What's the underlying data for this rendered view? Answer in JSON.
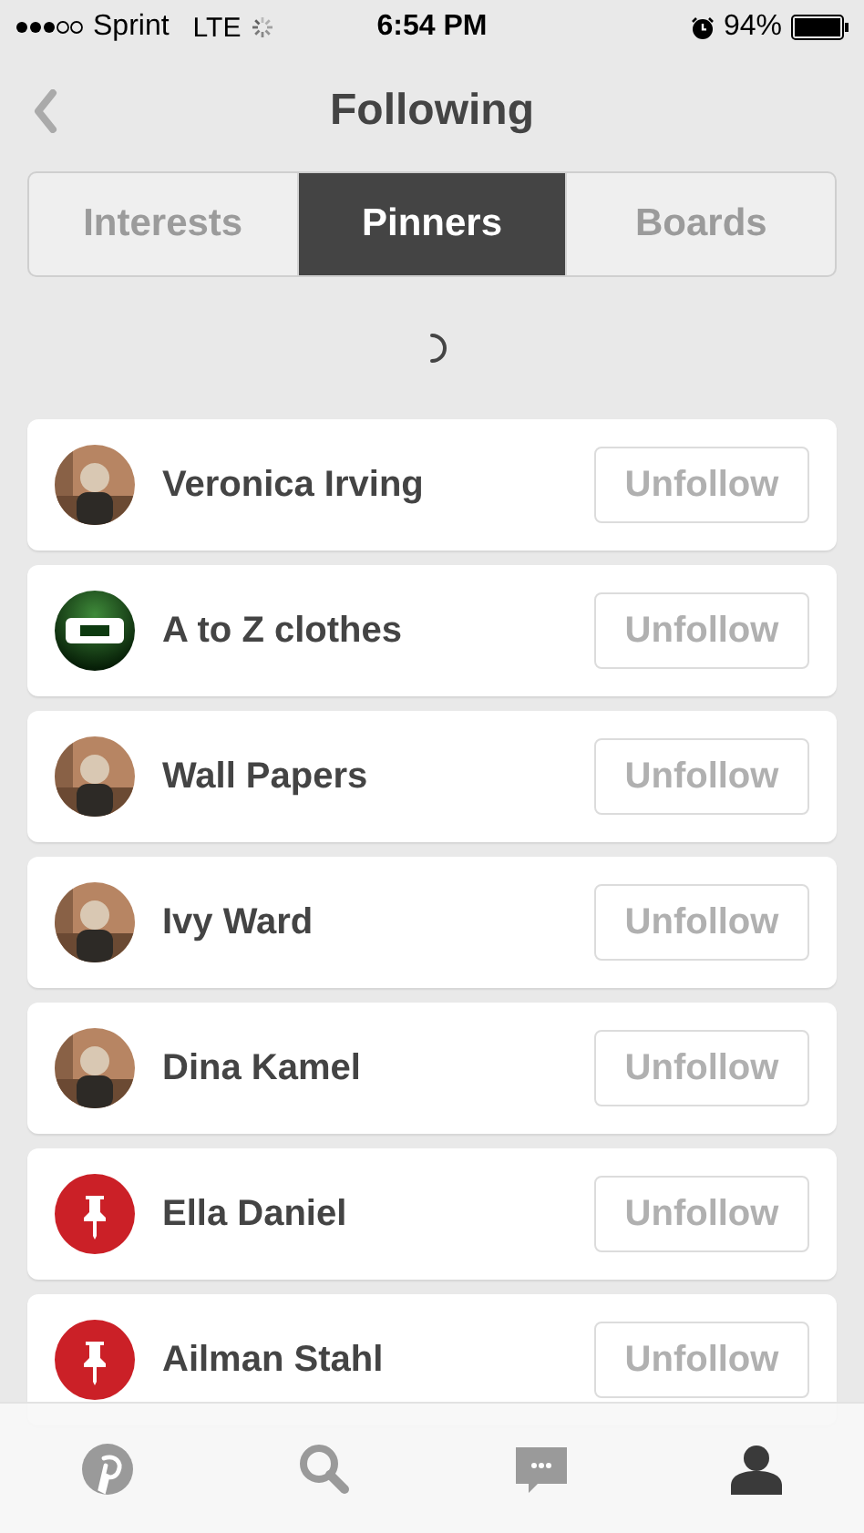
{
  "status_bar": {
    "carrier": "Sprint",
    "network": "LTE",
    "time": "6:54 PM",
    "battery": "94%"
  },
  "nav": {
    "title": "Following"
  },
  "tabs": [
    {
      "label": "Interests",
      "selected": false
    },
    {
      "label": "Pinners",
      "selected": true
    },
    {
      "label": "Boards",
      "selected": false
    }
  ],
  "following": [
    {
      "name": "Veronica Irving",
      "button": "Unfollow"
    },
    {
      "name": "A to Z clothes",
      "kind": "logo",
      "button": "Unfollow"
    },
    {
      "name": "Wall Papers",
      "button": "Unfollow"
    },
    {
      "name": "Ivy Ward",
      "button": "Unfollow"
    },
    {
      "name": "Dina Kamel",
      "button": "Unfollow"
    },
    {
      "name": "Ella Daniel",
      "kind": "pin",
      "button": "Unfollow"
    },
    {
      "name": "Ailman Stahl",
      "kind": "pin",
      "button": "Unfollow"
    }
  ],
  "tab_bar": [
    {
      "kind": "home",
      "selected": false
    },
    {
      "kind": "search",
      "selected": false
    },
    {
      "kind": "messages",
      "selected": false
    },
    {
      "kind": "profile",
      "selected": true
    }
  ]
}
